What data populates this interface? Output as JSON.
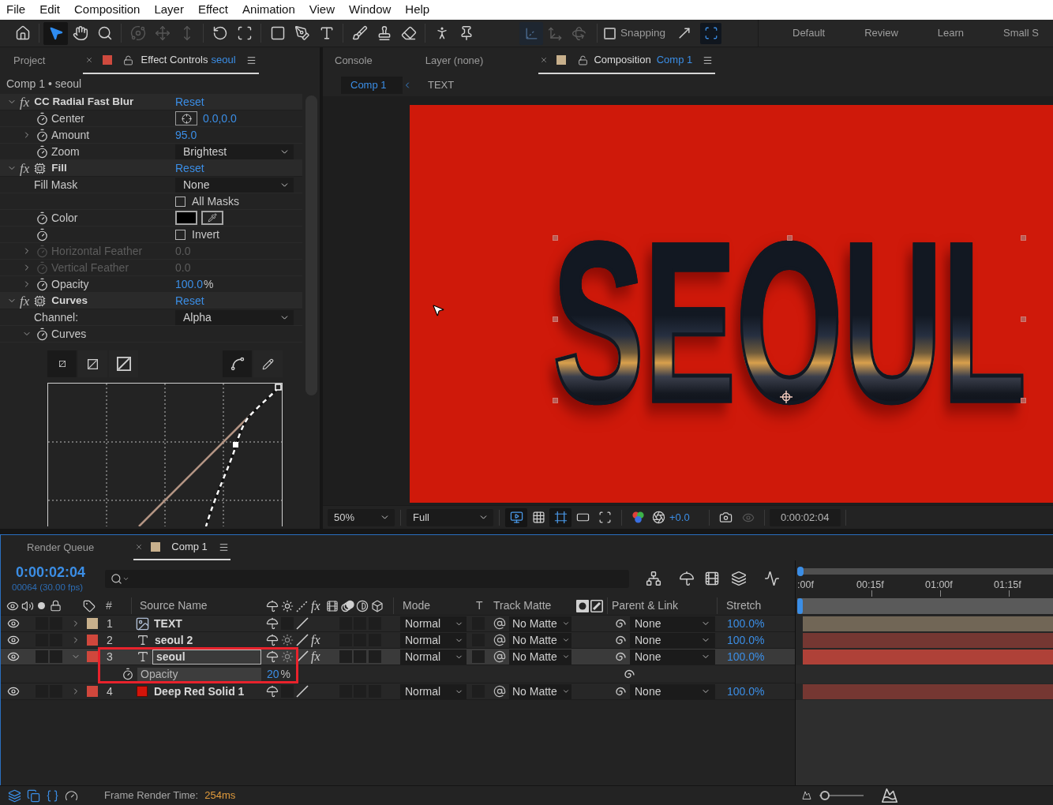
{
  "menu": [
    "File",
    "Edit",
    "Composition",
    "Layer",
    "Effect",
    "Animation",
    "View",
    "Window",
    "Help"
  ],
  "toolbar": {
    "tools": [
      {
        "kind": "home",
        "selected": false,
        "disabled": false
      },
      {
        "kind": "selection",
        "selected": true,
        "disabled": false
      },
      {
        "kind": "hand",
        "selected": false,
        "disabled": false
      },
      {
        "kind": "zoom",
        "selected": false,
        "disabled": false
      },
      {
        "kind": "orbit",
        "selected": false,
        "disabled": true
      },
      {
        "kind": "pan",
        "selected": false,
        "disabled": true
      },
      {
        "kind": "dolly",
        "selected": false,
        "disabled": true
      },
      {
        "kind": "rotation",
        "selected": false,
        "disabled": false
      },
      {
        "kind": "pan_behind",
        "selected": false,
        "disabled": false
      },
      {
        "kind": "rectangle",
        "selected": false,
        "disabled": false
      },
      {
        "kind": "pen",
        "selected": false,
        "disabled": false
      },
      {
        "kind": "type",
        "selected": false,
        "disabled": false
      },
      {
        "kind": "brush",
        "selected": false,
        "disabled": false
      },
      {
        "kind": "clone_stamp",
        "selected": false,
        "disabled": false
      },
      {
        "kind": "eraser",
        "selected": false,
        "disabled": false
      },
      {
        "kind": "roto_brush",
        "selected": false,
        "disabled": false
      },
      {
        "kind": "puppet",
        "selected": false,
        "disabled": false
      }
    ],
    "axis_modes": [
      {
        "kind": "local",
        "selected": true
      },
      {
        "kind": "world",
        "selected": false
      },
      {
        "kind": "view",
        "selected": false
      }
    ],
    "snapping": {
      "label": "Snapping",
      "checked": false
    },
    "expand_toggle": {
      "on": true
    },
    "workspaces": [
      "Default",
      "Review",
      "Learn",
      "Small S"
    ]
  },
  "effect_controls": {
    "project_tab": "Project",
    "title": "Effect Controls",
    "layer_name": "seoul",
    "breadcrumb": "Comp 1 • seoul",
    "effects": [
      {
        "badge": "fx",
        "name": "CC Radial Fast Blur",
        "reset": "Reset",
        "expanded": true,
        "gpu": false,
        "params": [
          {
            "kind": "point",
            "label": "Center",
            "value": "0.0,0.0",
            "stopwatch": true,
            "disabled": false
          },
          {
            "kind": "number",
            "label": "Amount",
            "value": "95.0",
            "stopwatch": true,
            "disabled": false,
            "expanded": false
          },
          {
            "kind": "dropdown",
            "label": "Zoom",
            "value": "Brightest",
            "stopwatch": true,
            "disabled": false
          }
        ]
      },
      {
        "badge": "fx",
        "name": "Fill",
        "reset": "Reset",
        "expanded": true,
        "gpu": true,
        "params": [
          {
            "kind": "dropdown",
            "label": "Fill Mask",
            "value": "None",
            "stopwatch": false,
            "disabled": false
          },
          {
            "kind": "checkbox",
            "label": "All Masks",
            "checked": false,
            "stopwatch": false,
            "disabled": false
          },
          {
            "kind": "color",
            "label": "Color",
            "color": "#000000",
            "stopwatch": true,
            "disabled": false
          },
          {
            "kind": "checkbox",
            "label": "Invert",
            "checked": false,
            "stopwatch": true,
            "disabled": false
          },
          {
            "kind": "number",
            "label": "Horizontal Feather",
            "value": "0.0",
            "stopwatch": true,
            "disabled": true,
            "expanded": false
          },
          {
            "kind": "number",
            "label": "Vertical Feather",
            "value": "0.0",
            "stopwatch": true,
            "disabled": true,
            "expanded": false
          },
          {
            "kind": "number",
            "label": "Opacity",
            "value": "100.0",
            "unit": "%",
            "stopwatch": true,
            "disabled": false,
            "expanded": false
          }
        ]
      },
      {
        "badge": "fx",
        "name": "Curves",
        "reset": "Reset",
        "expanded": true,
        "gpu": true,
        "params": [
          {
            "kind": "dropdown",
            "label": "Channel:",
            "value": "Alpha",
            "stopwatch": false,
            "disabled": false
          },
          {
            "kind": "curves",
            "label": "Curves",
            "stopwatch": true,
            "disabled": false,
            "expanded": true
          }
        ]
      }
    ]
  },
  "composition": {
    "tabs": [
      "Console",
      "Layer (none)"
    ],
    "title": "Composition",
    "comp_name": "Comp 1",
    "breadcrumbs": [
      {
        "label": "Comp 1",
        "selected": true
      },
      {
        "label": "TEXT",
        "selected": false
      }
    ],
    "frame_text": "SEOUL",
    "footer": {
      "zoom": "50%",
      "resolution": "Full",
      "toggles": [
        {
          "kind": "fast_preview",
          "on": true
        },
        {
          "kind": "transparency_grid",
          "on": false
        },
        {
          "kind": "mask_visibility",
          "on": true
        },
        {
          "kind": "region_of_interest",
          "on": false
        },
        {
          "kind": "grid_guides",
          "on": false
        }
      ],
      "exposure": "+0.0",
      "time": "0:00:02:04"
    }
  },
  "timeline": {
    "render_queue_tab": "Render Queue",
    "comp_tab": "Comp 1",
    "current_time": "0:00:02:04",
    "frame_info": "00064 (30.00 fps)",
    "ruler": [
      ":00f",
      "00:15f",
      "01:00f",
      "01:15f"
    ],
    "columns": {
      "number": "#",
      "source_name": "Source Name",
      "fx": "fx",
      "mode": "Mode",
      "t": "T",
      "track_matte": "Track Matte",
      "parent": "Parent & Link",
      "stretch": "Stretch"
    },
    "layers": [
      {
        "number": "1",
        "kind": "precomp",
        "name": "TEXT",
        "color": "#c8b08c",
        "visible": true,
        "selected": false,
        "expanded": false,
        "highlighted": false,
        "mode": "Normal",
        "track_matte": "No Matte",
        "parent": "None",
        "stretch": "100.0%"
      },
      {
        "number": "2",
        "kind": "text",
        "name": "seoul 2",
        "color": "#d0473c",
        "visible": true,
        "selected": false,
        "expanded": false,
        "highlighted": false,
        "fx": "fx",
        "mode": "Normal",
        "track_matte": "No Matte",
        "parent": "None",
        "stretch": "100.0%"
      },
      {
        "number": "3",
        "kind": "text",
        "name": "seoul",
        "color": "#d0473c",
        "visible": true,
        "selected": true,
        "expanded": true,
        "highlighted": true,
        "fx": "fx",
        "mode": "Normal",
        "track_matte": "No Matte",
        "parent": "None",
        "stretch": "100.0%",
        "properties": [
          {
            "name": "Opacity",
            "value": "20",
            "unit": "%"
          }
        ]
      },
      {
        "number": "4",
        "kind": "solid",
        "name": "Deep Red Solid 1",
        "color": "#d0473c",
        "visible": true,
        "selected": false,
        "expanded": false,
        "highlighted": false,
        "mode": "Normal",
        "track_matte": "No Matte",
        "parent": "None",
        "stretch": "100.0%"
      }
    ]
  },
  "status_bar": {
    "label": "Frame Render Time:",
    "value": "254ms",
    "zoom_slider": {
      "level": 0.12
    }
  }
}
